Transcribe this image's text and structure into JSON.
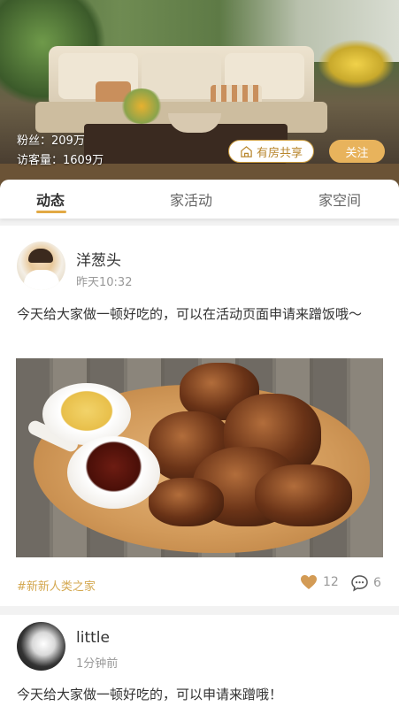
{
  "header": {
    "fans_label": "粉丝：209万",
    "visitors_label": "访客量：1609万",
    "share_button": "有房共享",
    "follow_button": "关注"
  },
  "tabs": [
    {
      "label": "动态",
      "active": true
    },
    {
      "label": "家活动",
      "active": false
    },
    {
      "label": "家空间",
      "active": false
    }
  ],
  "posts": [
    {
      "username": "洋葱头",
      "time": "昨天10:32",
      "text": "今天给大家做一顿好吃的，可以在活动页面申请来蹭饭哦～",
      "tag": "#新新人类之家",
      "likes": "12",
      "comments": "6"
    },
    {
      "username": "little",
      "time": "1分钟前",
      "text": "今天给大家做一顿好吃的，可以申请来蹭哦！"
    }
  ],
  "colors": {
    "accent": "#e2a944",
    "tag": "#d4a850",
    "follow_bg": "#e8b35c"
  },
  "icons": [
    "home-share-icon",
    "heart-icon",
    "comment-icon"
  ]
}
